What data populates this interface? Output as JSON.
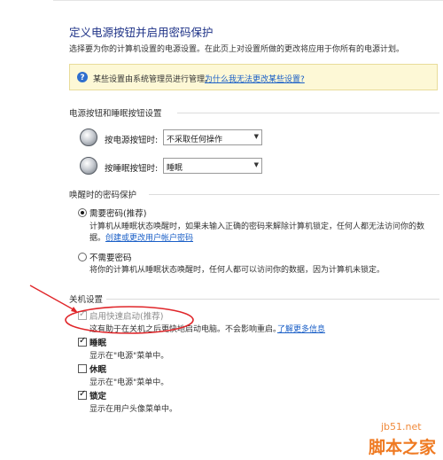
{
  "page": {
    "title": "定义电源按钮并启用密码保护",
    "subtitle": "选择要为你的计算机设置的电源设置。在此页上对设置所做的更改将应用于你所有的电源计划。"
  },
  "infobar": {
    "text": "某些设置由系统管理员进行管理。",
    "link": "为什么我无法更改某些设置?"
  },
  "buttons_section": {
    "label": "电源按钮和睡眠按钮设置",
    "power_label": "按电源按钮时:",
    "power_value": "不采取任何操作",
    "sleep_label": "按睡眠按钮时:",
    "sleep_value": "睡眠"
  },
  "wake_section": {
    "label": "唤醒时的密码保护",
    "require": {
      "label": "需要密码(推荐)",
      "desc1": "计算机从睡眠状态唤醒时，如果未输入正确的密码来解除计算机锁定，任何人都无法访问你的数",
      "desc2": "据。",
      "link": "创建或更改用户帐户密码"
    },
    "norequire": {
      "label": "不需要密码",
      "desc": "将你的计算机从睡眠状态唤醒时，任何人都可以访问你的数据，因为计算机未锁定。"
    }
  },
  "shutdown_section": {
    "label": "关机设置",
    "fast_startup": {
      "label": "启用快速启动(推荐)",
      "desc": "这有助于在关机之后更快地启动电脑。不会影响重启。",
      "link": "了解更多信息"
    },
    "sleep": {
      "label": "睡眠",
      "desc": "显示在\"电源\"菜单中。"
    },
    "hibernate": {
      "label": "休眠",
      "desc": "显示在\"电源\"菜单中。"
    },
    "lock": {
      "label": "锁定",
      "desc": "显示在用户头像菜单中。"
    }
  },
  "watermark": {
    "site": "jb51.net",
    "brand": "脚本之家"
  },
  "colors": {
    "title": "#1e3287",
    "link": "#1a5fc7",
    "infobar_bg": "#fdf8d6",
    "annotation": "#e0262a",
    "watermark": "#ef7a22"
  }
}
